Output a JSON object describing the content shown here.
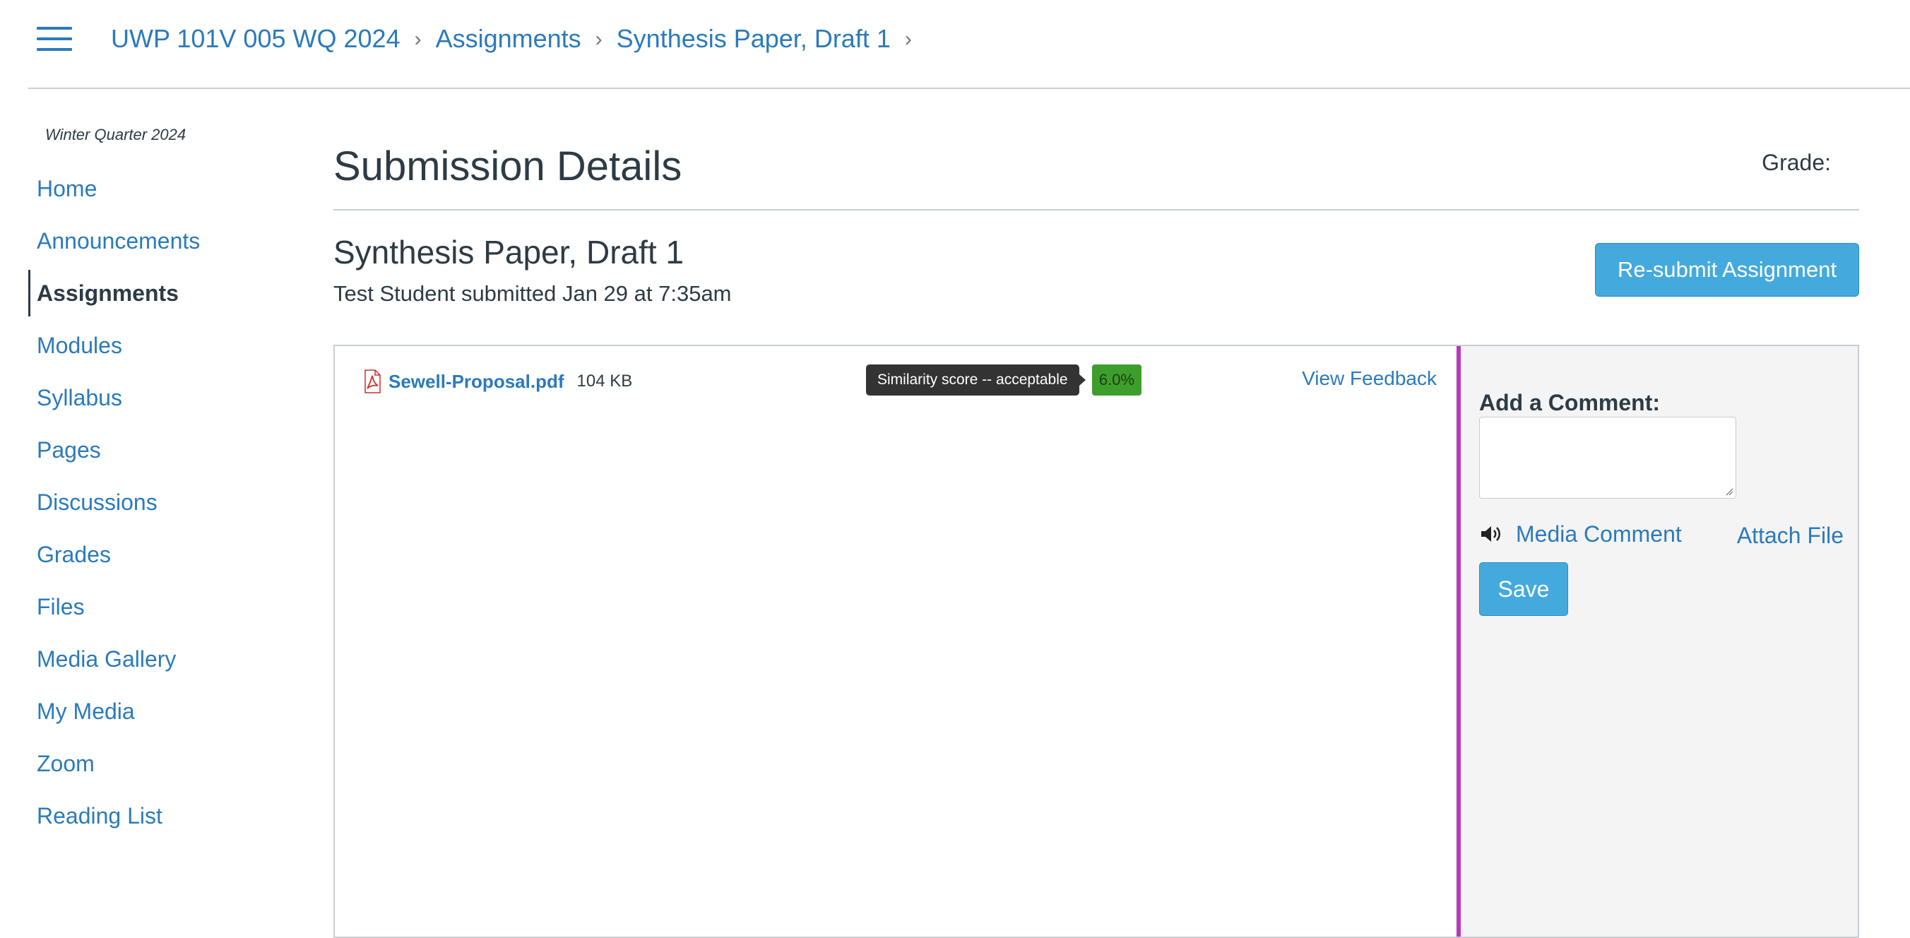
{
  "breadcrumb": {
    "course": "UWP 101V 005 WQ 2024",
    "section": "Assignments",
    "item": "Synthesis Paper, Draft 1"
  },
  "sidebar": {
    "term": "Winter Quarter 2024",
    "items": [
      {
        "label": "Home"
      },
      {
        "label": "Announcements"
      },
      {
        "label": "Assignments",
        "active": true
      },
      {
        "label": "Modules"
      },
      {
        "label": "Syllabus"
      },
      {
        "label": "Pages"
      },
      {
        "label": "Discussions"
      },
      {
        "label": "Grades"
      },
      {
        "label": "Files"
      },
      {
        "label": "Media Gallery"
      },
      {
        "label": "My Media"
      },
      {
        "label": "Zoom"
      },
      {
        "label": "Reading List"
      }
    ]
  },
  "main": {
    "title": "Submission Details",
    "grade_label": "Grade:",
    "assignment_title": "Synthesis Paper, Draft 1",
    "submitted_text": "Test Student submitted Jan 29 at 7:35am",
    "resubmit_label": "Re-submit Assignment"
  },
  "file": {
    "icon": "pdf-icon",
    "name": "Sewell-Proposal.pdf",
    "size": "104 KB",
    "tooltip": "Similarity score -- acceptable",
    "score": "6.0%",
    "view_feedback": "View Feedback"
  },
  "comment": {
    "label": "Add a Comment:",
    "media_icon": "speaker-icon",
    "media_label": "Media Comment",
    "attach_label": "Attach File",
    "save_label": "Save"
  },
  "colors": {
    "link": "#2b7abc",
    "button": "#44aade",
    "divider": "#b73ab7",
    "score_badge": "#3d9e2c"
  }
}
